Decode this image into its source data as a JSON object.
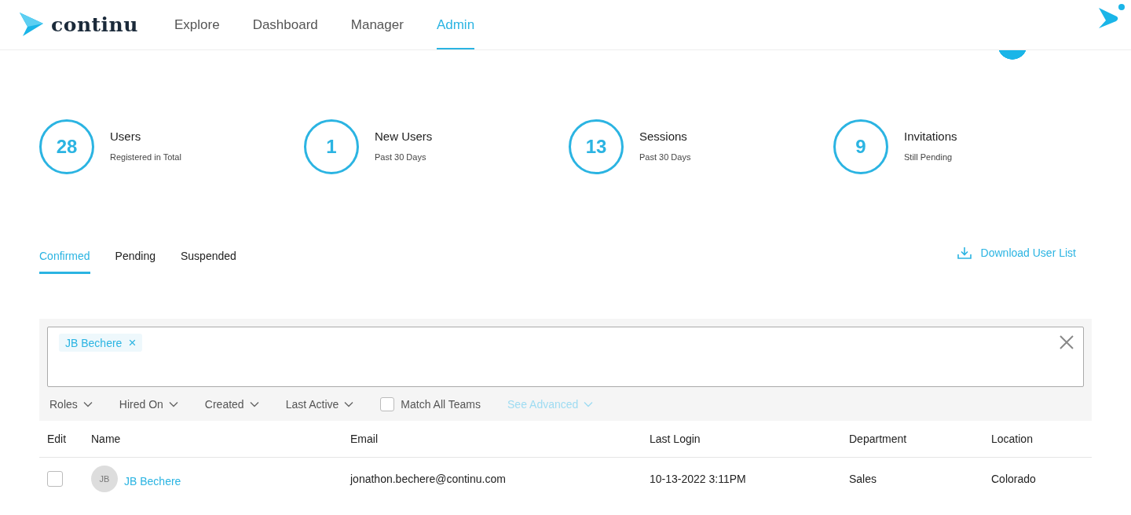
{
  "header": {
    "logo": "continu",
    "nav": [
      {
        "label": "Explore",
        "selected": false
      },
      {
        "label": "Dashboard",
        "selected": false
      },
      {
        "label": "Manager",
        "selected": false
      },
      {
        "label": "Admin",
        "selected": true
      }
    ]
  },
  "stats": [
    {
      "value": "28",
      "label": "Users",
      "sublabel": "Registered in Total"
    },
    {
      "value": "1",
      "label": "New Users",
      "sublabel": "Past 30 Days"
    },
    {
      "value": "13",
      "label": "Sessions",
      "sublabel": "Past 30 Days"
    },
    {
      "value": "9",
      "label": "Invitations",
      "sublabel": "Still Pending"
    }
  ],
  "tabs": [
    {
      "label": "Confirmed",
      "selected": true
    },
    {
      "label": "Pending",
      "selected": false
    },
    {
      "label": "Suspended",
      "selected": false
    }
  ],
  "download": "Download User List",
  "filter": {
    "chips": [
      {
        "label": "JB Bechere",
        "remove": "×"
      }
    ],
    "dropdowns": [
      {
        "label": "Roles"
      },
      {
        "label": "Hired On"
      },
      {
        "label": "Created"
      },
      {
        "label": "Last Active"
      }
    ],
    "match_all_teams": {
      "label": "Match All Teams",
      "checked": false
    },
    "advanced": "See Advanced"
  },
  "table": {
    "columns": [
      "Edit",
      "Name",
      "Email",
      "Last Login",
      "Department",
      "Location"
    ],
    "rows": [
      {
        "checked": false,
        "initials": "JB",
        "name": "JB Bechere",
        "email": "jonathon.bechere@continu.com",
        "last_login": "10-13-2022 3:11PM",
        "department": "Sales",
        "location": "Colorado"
      }
    ]
  }
}
